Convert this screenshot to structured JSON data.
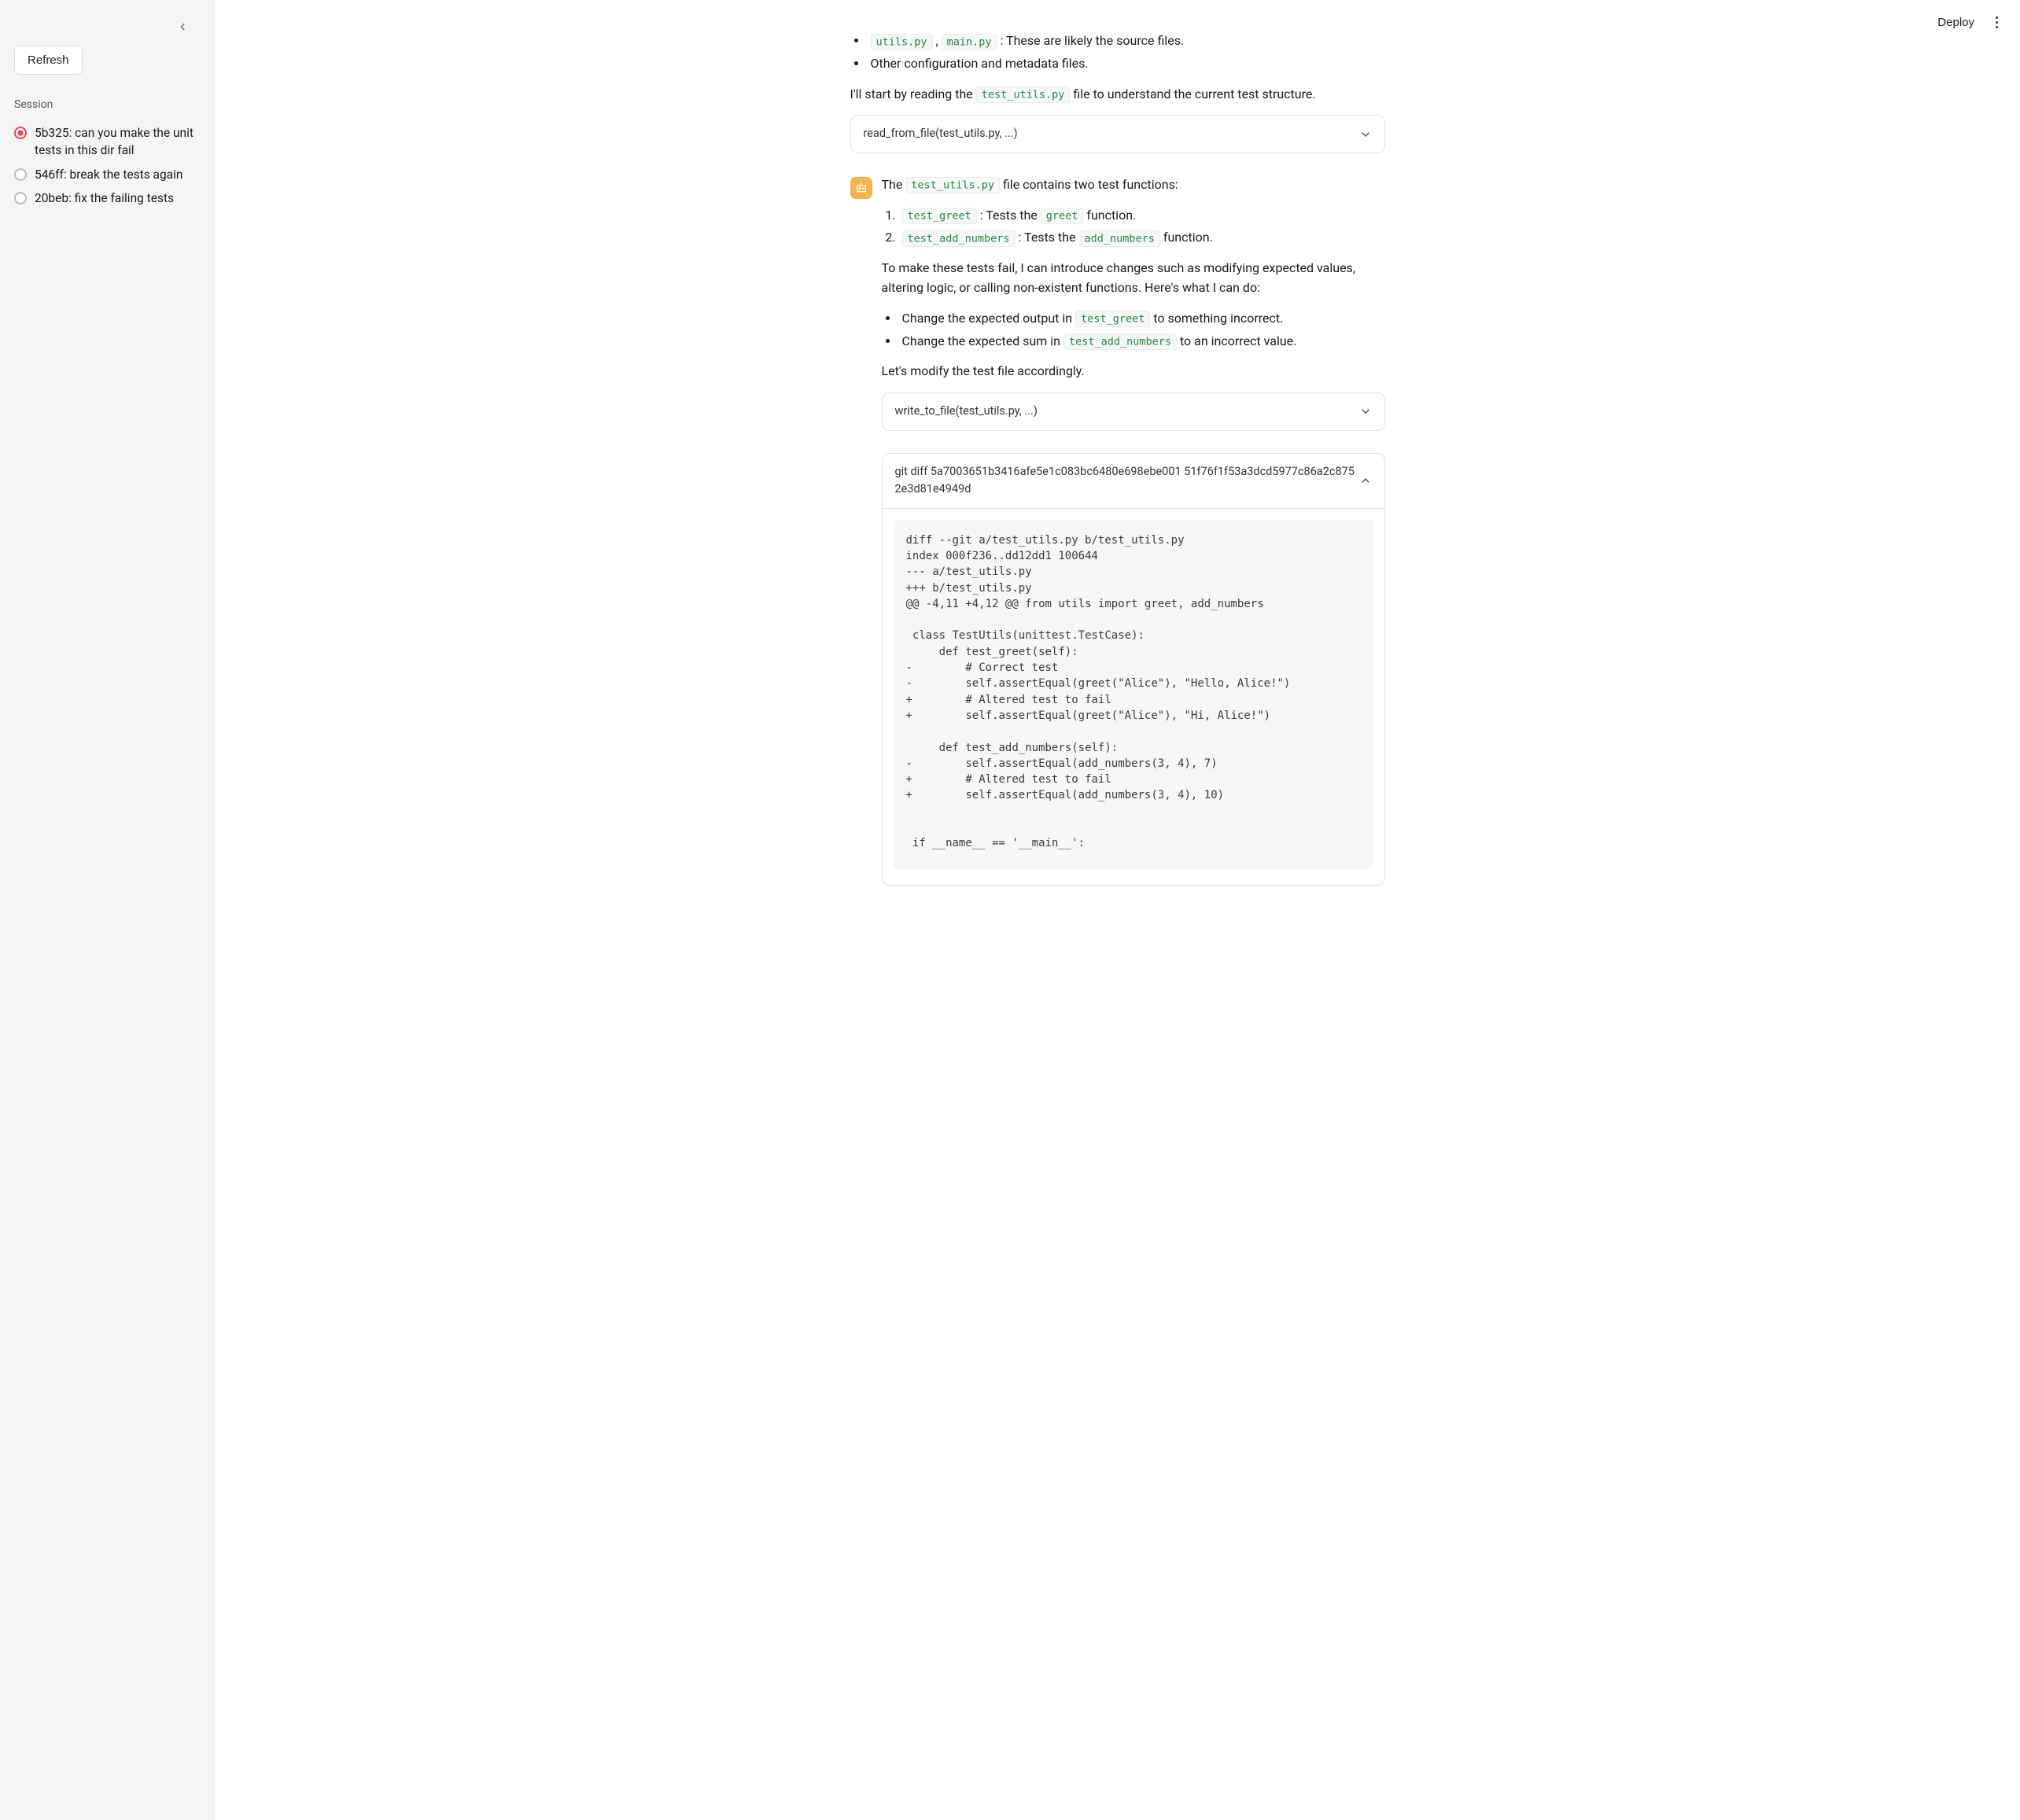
{
  "topbar": {
    "deploy_label": "Deploy"
  },
  "sidebar": {
    "refresh_label": "Refresh",
    "session_heading": "Session",
    "sessions": [
      {
        "label": "5b325: can you make the unit tests in this dir fail",
        "active": true
      },
      {
        "label": "546ff: break the tests again",
        "active": false
      },
      {
        "label": "20beb: fix the failing tests",
        "active": false
      }
    ]
  },
  "message_top": {
    "bullets": [
      {
        "codes": [
          "utils.py",
          "main.py"
        ],
        "text_after": ": These are likely the source files."
      },
      {
        "codes": [],
        "text_after": "Other configuration and metadata files."
      }
    ],
    "para1_before": "I'll start by reading the ",
    "para1_code": "test_utils.py",
    "para1_after": " file to understand the current test structure."
  },
  "tool_read": {
    "title": "read_from_file(test_utils.py, ...)"
  },
  "message_bot": {
    "line1_before": "The ",
    "line1_code": "test_utils.py",
    "line1_after": " file contains two test functions:",
    "numbered": [
      {
        "code1": "test_greet",
        "mid": ": Tests the ",
        "code2": "greet",
        "after": " function."
      },
      {
        "code1": "test_add_numbers",
        "mid": ": Tests the ",
        "code2": "add_numbers",
        "after": " function."
      }
    ],
    "para2": "To make these tests fail, I can introduce changes such as modifying expected values, altering logic, or calling non-existent functions. Here's what I can do:",
    "bullets2": [
      {
        "before": "Change the expected output in ",
        "code": "test_greet",
        "after": " to something incorrect."
      },
      {
        "before": "Change the expected sum in ",
        "code": "test_add_numbers",
        "after": " to an incorrect value."
      }
    ],
    "para3": "Let's modify the test file accordingly."
  },
  "tool_write": {
    "title": "write_to_file(test_utils.py, ...)"
  },
  "tool_diff": {
    "title": "git diff 5a7003651b3416afe5e1c083bc6480e698ebe001 51f76f1f53a3dcd5977c86a2c8752e3d81e4949d",
    "body": "diff --git a/test_utils.py b/test_utils.py\nindex 000f236..dd12dd1 100644\n--- a/test_utils.py\n+++ b/test_utils.py\n@@ -4,11 +4,12 @@ from utils import greet, add_numbers\n\n class TestUtils(unittest.TestCase):\n     def test_greet(self):\n-        # Correct test\n-        self.assertEqual(greet(\"Alice\"), \"Hello, Alice!\")\n+        # Altered test to fail\n+        self.assertEqual(greet(\"Alice\"), \"Hi, Alice!\")\n\n     def test_add_numbers(self):\n-        self.assertEqual(add_numbers(3, 4), 7)\n+        # Altered test to fail\n+        self.assertEqual(add_numbers(3, 4), 10)\n\n\n if __name__ == '__main__':"
  }
}
